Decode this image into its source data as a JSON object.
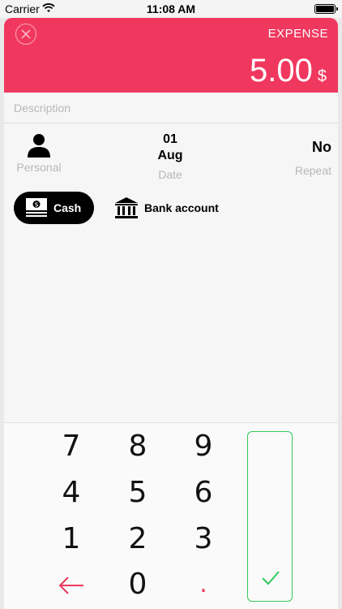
{
  "status_bar": {
    "carrier": "Carrier",
    "time": "11:08 AM",
    "wifi_icon": "wifi-icon",
    "battery_level": 1.0
  },
  "header": {
    "type_label": "EXPENSE",
    "amount": "5.00",
    "currency": "$",
    "close_icon": "close-icon",
    "color": "#f0385f"
  },
  "description": {
    "value": "",
    "placeholder": "Description"
  },
  "meta": {
    "personal_label": "Personal",
    "person_icon": "person-icon",
    "date_day": "01",
    "date_month": "Aug",
    "date_label": "Date",
    "repeat_value": "No",
    "repeat_label": "Repeat"
  },
  "accounts": {
    "cash_label": "Cash",
    "cash_icon": "cash-icon",
    "bank_label": "Bank account",
    "bank_icon": "bank-icon",
    "selected": "Cash"
  },
  "keypad": {
    "keys": [
      "7",
      "8",
      "9",
      "4",
      "5",
      "6",
      "1",
      "2",
      "3",
      "0",
      "."
    ],
    "backspace_icon": "back-arrow-icon",
    "confirm_icon": "checkmark-icon",
    "accent_color": "#33c759"
  }
}
